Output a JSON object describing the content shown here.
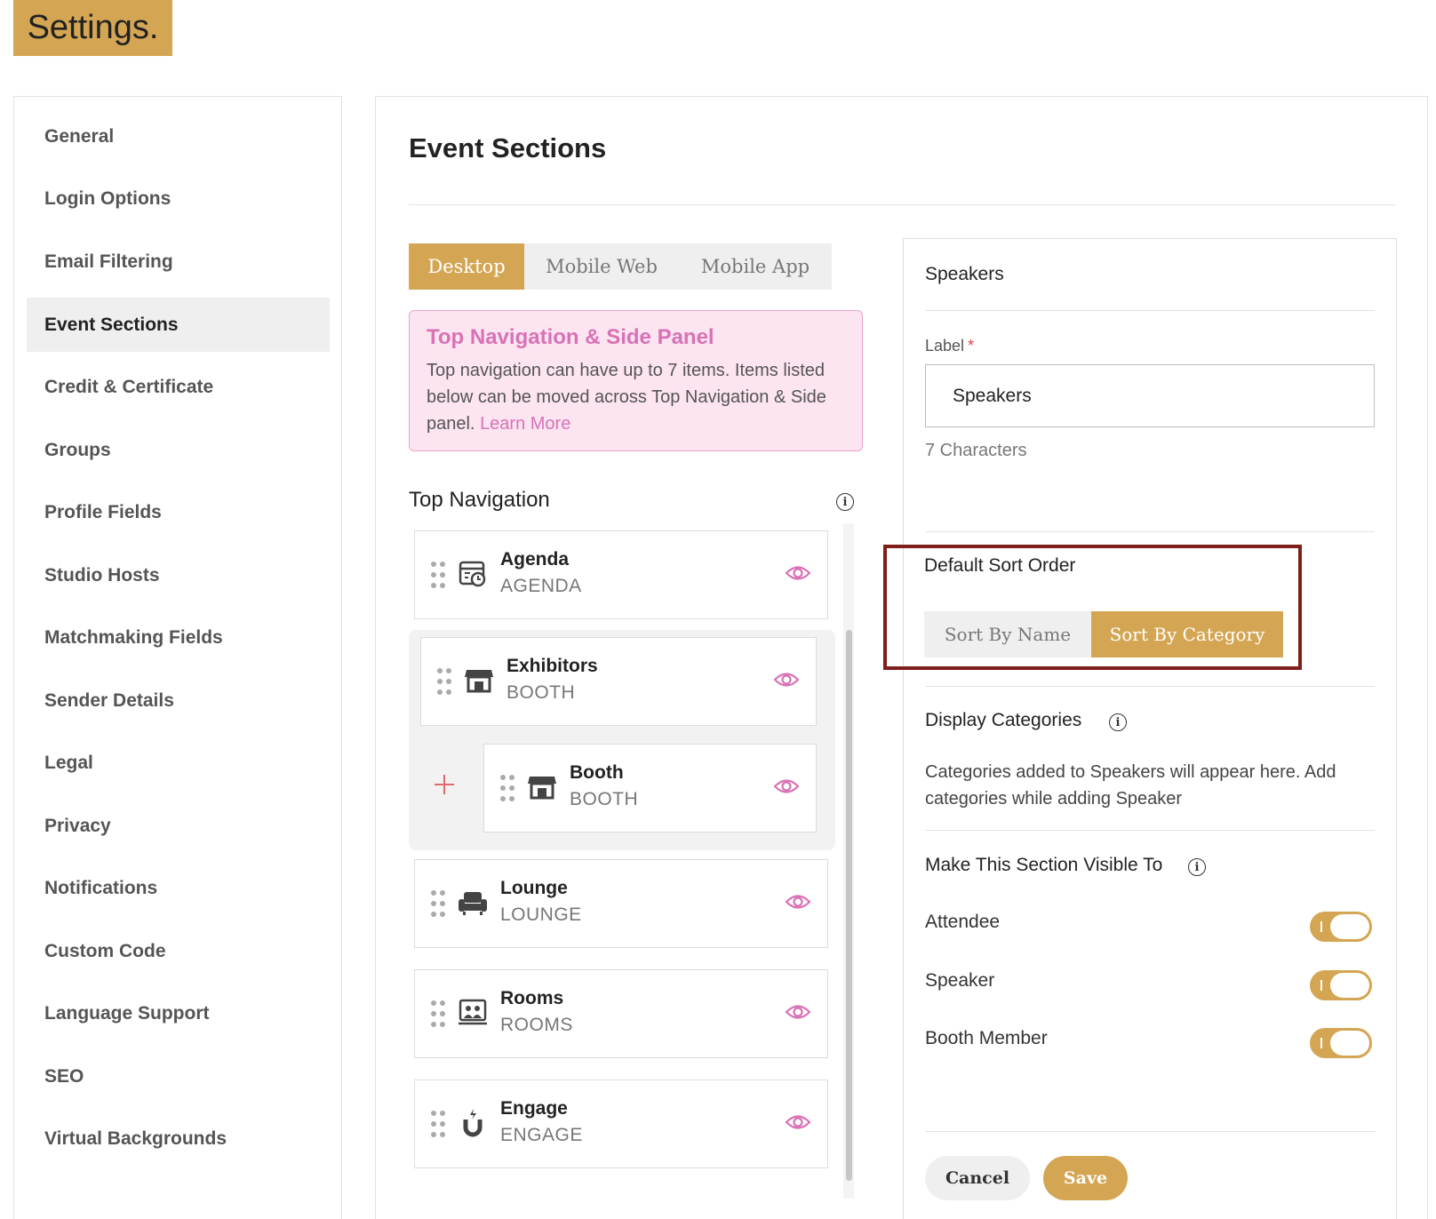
{
  "page_title": "Settings.",
  "colors": {
    "accent": "#d4a654",
    "notice_bg": "#fce4f1",
    "notice_accent": "#d872b5",
    "highlight_border": "#7f1f1a"
  },
  "sidebar": {
    "items": [
      {
        "label": "General",
        "active": false
      },
      {
        "label": "Login Options",
        "active": false
      },
      {
        "label": "Email Filtering",
        "active": false
      },
      {
        "label": "Event Sections",
        "active": true
      },
      {
        "label": "Credit & Certificate",
        "active": false
      },
      {
        "label": "Groups",
        "active": false
      },
      {
        "label": "Profile Fields",
        "active": false
      },
      {
        "label": "Studio Hosts",
        "active": false
      },
      {
        "label": "Matchmaking Fields",
        "active": false
      },
      {
        "label": "Sender Details",
        "active": false
      },
      {
        "label": "Legal",
        "active": false
      },
      {
        "label": "Privacy",
        "active": false
      },
      {
        "label": "Notifications",
        "active": false
      },
      {
        "label": "Custom Code",
        "active": false
      },
      {
        "label": "Language Support",
        "active": false
      },
      {
        "label": "SEO",
        "active": false
      },
      {
        "label": "Virtual Backgrounds",
        "active": false
      }
    ]
  },
  "main": {
    "title": "Event Sections",
    "tabs": [
      {
        "label": "Desktop",
        "active": true
      },
      {
        "label": "Mobile Web",
        "active": false
      },
      {
        "label": "Mobile App",
        "active": false
      }
    ],
    "notice": {
      "title": "Top Navigation & Side Panel",
      "text": "Top navigation can have up to 7 items. Items listed below can be moved across Top Navigation & Side panel.",
      "link": "Learn More"
    },
    "top_navigation": {
      "title": "Top Navigation",
      "items": [
        {
          "name": "Agenda",
          "sub": "AGENDA",
          "icon": "calendar-clock-icon"
        },
        {
          "name": "Exhibitors",
          "sub": "BOOTH",
          "icon": "store-icon"
        },
        {
          "name": "Booth",
          "sub": "BOOTH",
          "icon": "store-icon"
        },
        {
          "name": "Lounge",
          "sub": "LOUNGE",
          "icon": "armchair-icon"
        },
        {
          "name": "Rooms",
          "sub": "ROOMS",
          "icon": "rooms-icon"
        },
        {
          "name": "Engage",
          "sub": "ENGAGE",
          "icon": "magnet-icon"
        }
      ]
    }
  },
  "panel": {
    "heading": "Speakers",
    "label_field": {
      "label": "Label",
      "required_mark": "*",
      "value": "Speakers",
      "char_count": "7 Characters"
    },
    "sort": {
      "title": "Default Sort Order",
      "options": [
        {
          "label": "Sort By Name",
          "active": false
        },
        {
          "label": "Sort By Category",
          "active": true
        }
      ]
    },
    "display_categories": {
      "title": "Display Categories",
      "text": "Categories added to Speakers will appear here. Add categories while adding Speaker"
    },
    "visibility": {
      "title": "Make This Section Visible To",
      "roles": [
        {
          "label": "Attendee",
          "enabled": true
        },
        {
          "label": "Speaker",
          "enabled": true
        },
        {
          "label": "Booth Member",
          "enabled": true
        }
      ]
    },
    "cancel_label": "Cancel",
    "save_label": "Save"
  }
}
